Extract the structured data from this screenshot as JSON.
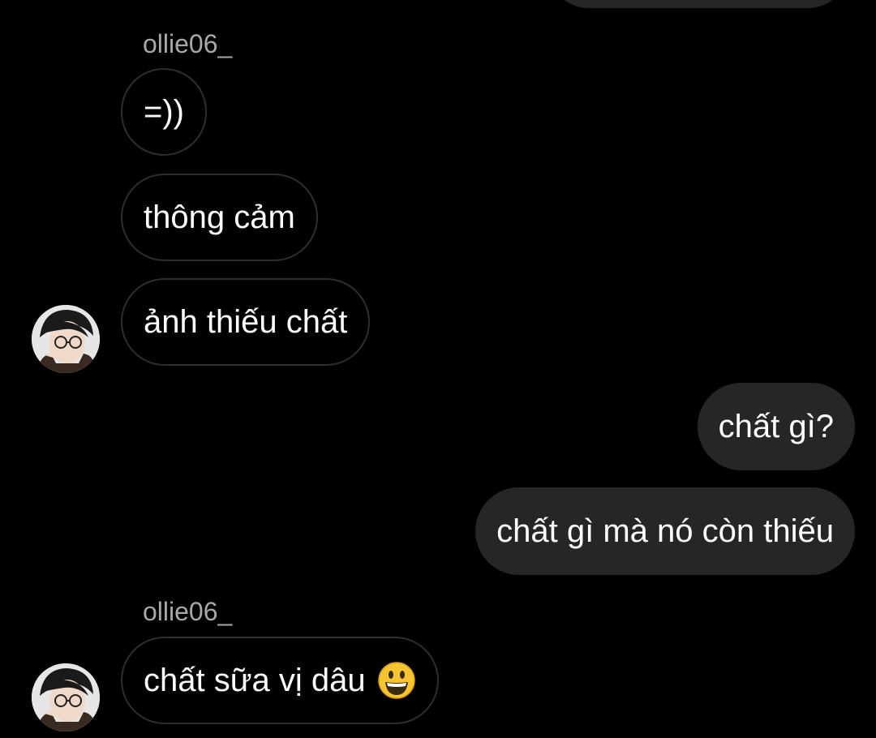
{
  "thread": {
    "top_partial": "",
    "groups": [
      {
        "sender": "ollie06_",
        "messages": [
          "=))",
          "thông cảm",
          "ảnh thiếu chất"
        ]
      },
      {
        "sent": [
          "chất gì?",
          "chất gì mà nó còn thiếu"
        ]
      },
      {
        "sender": "ollie06_",
        "messages": [
          "chất sữa vị dâu"
        ],
        "emoji": "grinning-face-emoji"
      }
    ]
  },
  "colors": {
    "background": "#000000",
    "sent_bubble": "#262626",
    "received_border": "#2e2e2e",
    "sender_name": "#a8a8a8"
  },
  "icons": {
    "avatar": "profile-photo",
    "emoji": "grinning-face-emoji"
  }
}
